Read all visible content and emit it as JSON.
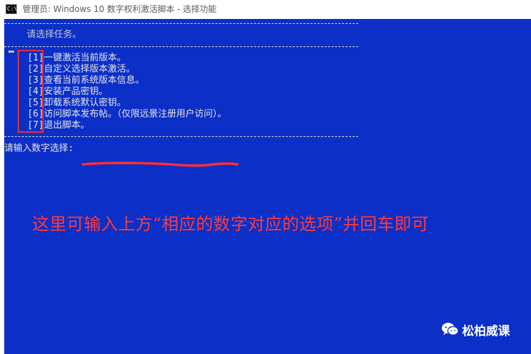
{
  "window": {
    "title": "管理员:  Windows 10 数字权利激活脚本 - 选择功能",
    "icon": "cmd-icon",
    "icon_glyph": "C:\\"
  },
  "console": {
    "prompt_header": "请选择任务。",
    "separator": "------------------------------------------------------------",
    "menu": [
      {
        "key": "[1]",
        "label": "一键激活当前版本。"
      },
      {
        "key": "[2]",
        "label": "自定义选择版本激活。"
      },
      {
        "key": "[3]",
        "label": "查看当前系统版本信息。"
      },
      {
        "key": "[4]",
        "label": "安装产品密钥。"
      },
      {
        "key": "[5]",
        "label": "卸载系统默认密钥。"
      },
      {
        "key": "[6]",
        "label": "访问脚本发布帖。（仅限远景注册用户访问）。"
      },
      {
        "key": "[7]",
        "label": "退出脚本。"
      }
    ],
    "input_prompt": "请输入数字选择:"
  },
  "annotation": {
    "text": "这里可输入上方“相应的数字对应的选项”并回车即可"
  },
  "watermark": {
    "text": "松柏威课",
    "icon": "wechat-icon"
  },
  "colors": {
    "console_bg": "#0c2fc8",
    "console_text": "#c8c8c8",
    "annotation_red": "#ff3a3a",
    "highlight_border": "#e0343a"
  }
}
